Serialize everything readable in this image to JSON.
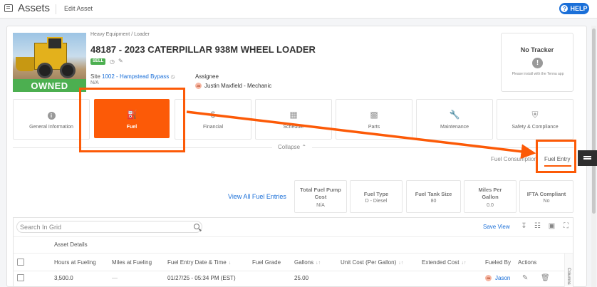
{
  "topbar": {
    "title": "Assets",
    "crumb": "Edit Asset",
    "help": "HELP"
  },
  "asset": {
    "category": "Heavy Equipment / Loader",
    "title": "48187 - 2023 CATERPILLAR 938M WHEEL LOADER",
    "badge": "SELL",
    "ownership": "OWNED",
    "site_label": "Site",
    "site_value": "1002 - Hampstead Bypass",
    "site_sub": "N/A",
    "assignee_label": "Assignee",
    "assignee_initials": "JM",
    "assignee_value": "Justin Maxfield - Mechanic"
  },
  "tracker": {
    "title": "No Tracker",
    "note": "Please install with the Tenna app"
  },
  "tiles": [
    {
      "label": "General Information",
      "icon": "info-icon"
    },
    {
      "label": "Fuel",
      "icon": "fuel-pump-icon"
    },
    {
      "label": "Financial",
      "icon": "dollar-icon"
    },
    {
      "label": "Schedule",
      "icon": "calendar-icon"
    },
    {
      "label": "Parts",
      "icon": "parts-icon"
    },
    {
      "label": "Maintenance",
      "icon": "wrench-icon"
    },
    {
      "label": "Safety & Compliance",
      "icon": "shield-icon"
    }
  ],
  "collapse_label": "Collapse",
  "subtabs": {
    "consumption": "Fuel Consumption",
    "entry": "Fuel Entry"
  },
  "view_all": "View All Fuel Entries",
  "stats": [
    {
      "label": "Total Fuel Pump Cost",
      "value": "N/A"
    },
    {
      "label": "Fuel Type",
      "value": "D - Diesel"
    },
    {
      "label": "Fuel Tank Size",
      "value": "80"
    },
    {
      "label": "Miles Per Gallon",
      "value": "0.0"
    },
    {
      "label": "IFTA Compliant",
      "value": "No"
    }
  ],
  "grid": {
    "search_placeholder": "Search In Grid",
    "save_view": "Save View",
    "group_header": "Asset Details",
    "columns": [
      "Hours at Fueling",
      "Miles at Fueling",
      "Fuel Entry Date & Time",
      "Fuel Grade",
      "Gallons",
      "Unit Cost (Per Gallon)",
      "Extended Cost",
      "Fueled By",
      "Actions"
    ],
    "side_panel": "Columns",
    "rows": [
      {
        "hours": "3,500.0",
        "miles": "—",
        "datetime": "01/27/25 - 05:34 PM (EST)",
        "grade": "",
        "gallons": "25.00",
        "unit_cost": "",
        "ext_cost": "",
        "fueled_by_initials": "JM",
        "fueled_by": "Jason"
      }
    ]
  },
  "colors": {
    "accent": "#fc5a07",
    "link": "#1a6fd8",
    "owned": "#4caf50"
  }
}
